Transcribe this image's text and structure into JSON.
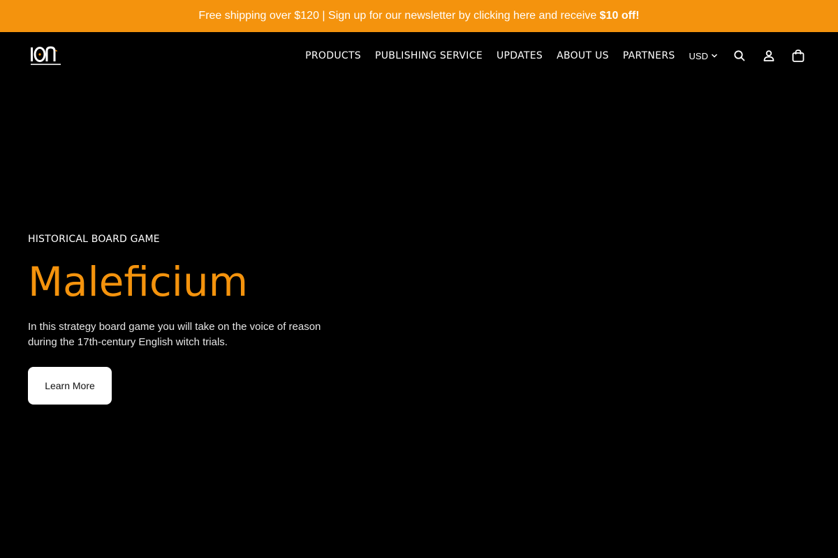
{
  "announcement": {
    "text": "Free shipping over $120 | Sign up for our newsletter by clicking here and receive ",
    "highlight": "$10 off!"
  },
  "header": {
    "logo_alt": "ION GAME DESIGN",
    "nav": [
      {
        "label": "PRODUCTS"
      },
      {
        "label": "PUBLISHING SERVICE"
      },
      {
        "label": "UPDATES"
      },
      {
        "label": "ABOUT US"
      },
      {
        "label": "PARTNERS"
      }
    ],
    "currency": "USD",
    "icons": [
      "search-icon",
      "account-icon",
      "cart-icon"
    ]
  },
  "hero": {
    "eyebrow": "HISTORICAL BOARD GAME",
    "title": "Maleficium",
    "description": "In this strategy board game you will take on the voice of reason during the 17th-century English witch trials.",
    "button_label": "Learn More"
  },
  "colors": {
    "accent": "#f4930d",
    "background": "#000000",
    "text": "#ffffff"
  }
}
